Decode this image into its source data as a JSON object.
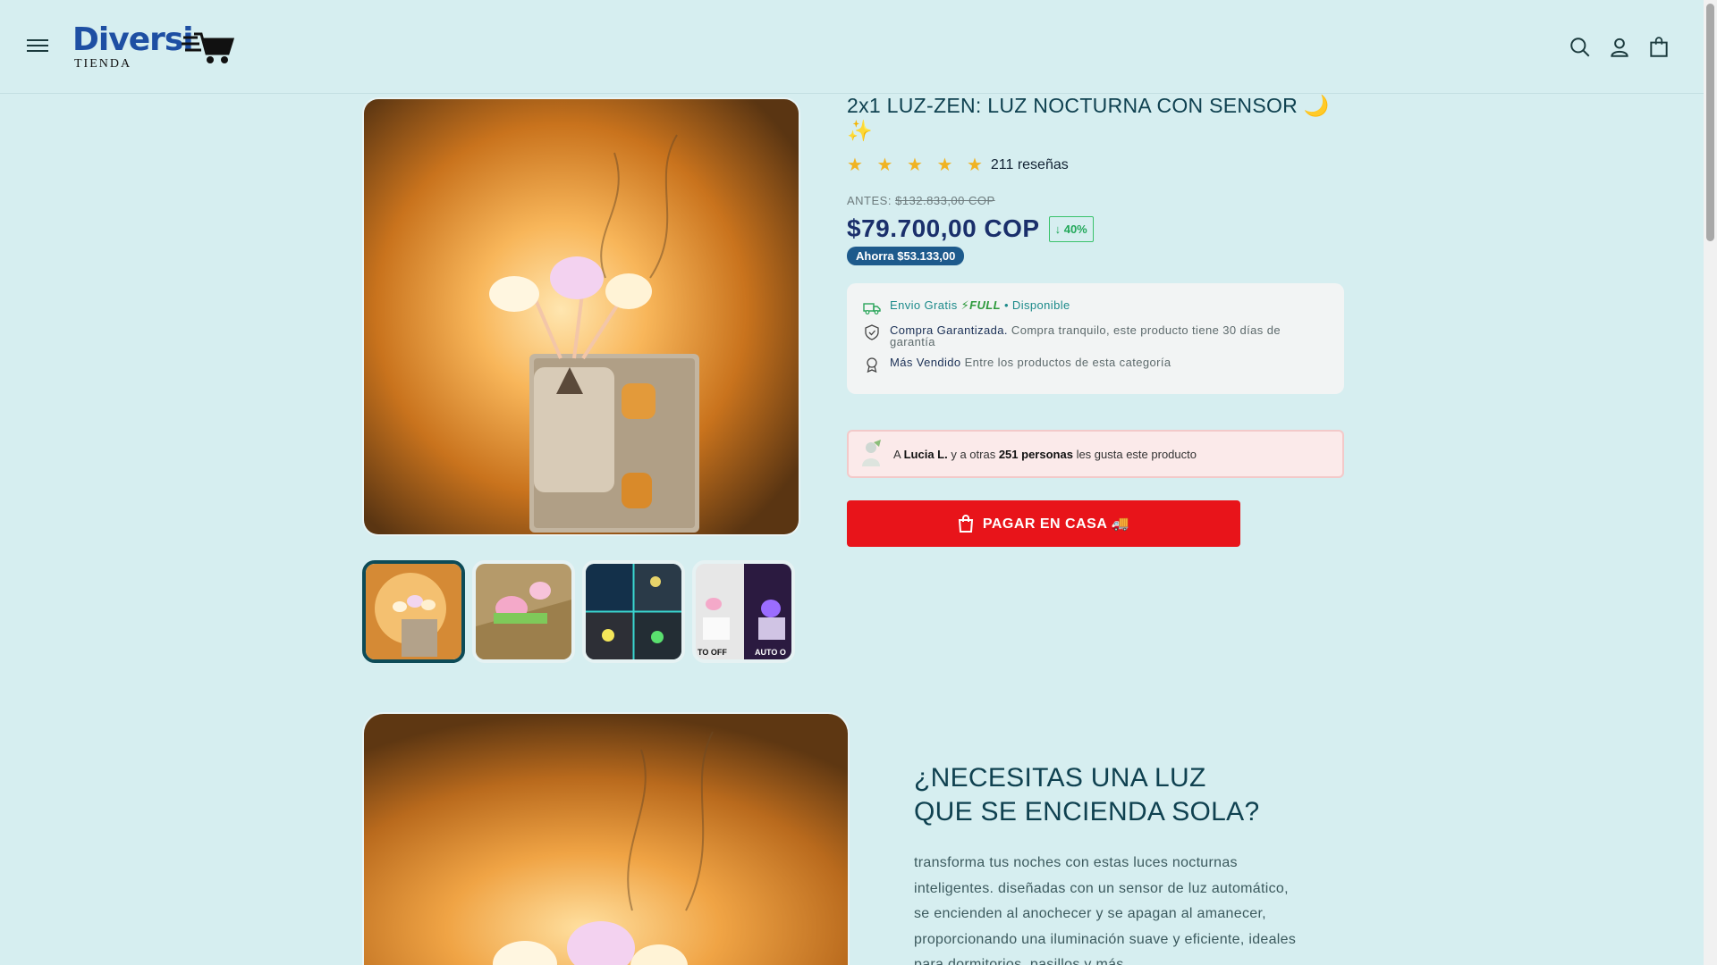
{
  "header": {
    "logo_main": "Diversi",
    "logo_sub": "TIENDA",
    "icons": [
      "menu-icon",
      "search-icon",
      "account-icon",
      "cart-icon"
    ]
  },
  "product": {
    "title": "2x1 LUZ-ZEN: LUZ NOCTURNA CON SENSOR 🌙✨",
    "stars": "★ ★ ★ ★ ★",
    "rating_value": 5,
    "reviews": "211 reseñas",
    "antes_label": "ANTES:",
    "antes_price": "$132.833,00 COP",
    "price": "$79.700,00 COP",
    "discount": "40%",
    "savings": "Ahorra $53.133,00"
  },
  "features": {
    "shipping_label": "Envio Gratis",
    "full_label": "FULL",
    "available": "• Disponible",
    "guarantee_title": "Compra Garantizada.",
    "guarantee_text": "Compra tranquilo, este producto tiene 30 días de garantía",
    "bestseller_title": "Más Vendido",
    "bestseller_text": "Entre los productos de esta categoría"
  },
  "likes": {
    "prefix": "A",
    "name": "Lucia L.",
    "middle": "y a otras",
    "count": "251 personas",
    "suffix": "les gusta este producto"
  },
  "cta": {
    "label": "PAGAR EN CASA 🚚"
  },
  "thumbnails": {
    "labels": [
      "AUTO OFF",
      "AUTO O"
    ]
  },
  "section": {
    "heading_line1": "¿NECESITAS UNA LUZ",
    "heading_line2": "QUE SE ENCIENDA SOLA?",
    "body": "transforma tus noches con estas luces nocturnas inteligentes. diseñadas con un sensor de luz automático, se encienden al anochecer y se apagan al amanecer, proporcionando una iluminación suave y eficiente, ideales para dormitorios, pasillos y más."
  },
  "colors": {
    "background": "#d6eef0",
    "accent_red": "#e8141a",
    "price_navy": "#1a2f6b",
    "heading_teal": "#0f4150"
  }
}
